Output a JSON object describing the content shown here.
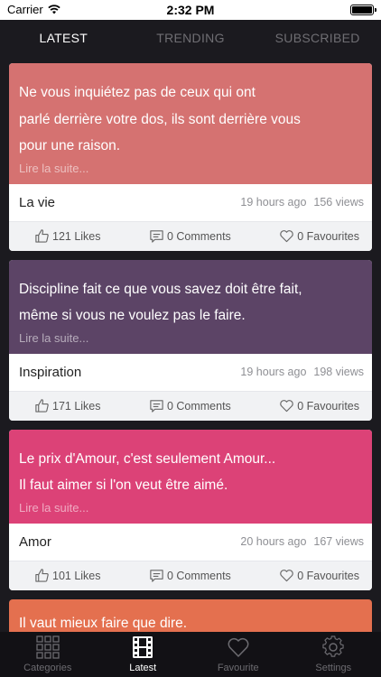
{
  "status_bar": {
    "carrier": "Carrier",
    "time": "2:32 PM"
  },
  "top_tabs": [
    {
      "label": "LATEST",
      "active": true
    },
    {
      "label": "TRENDING",
      "active": false
    },
    {
      "label": "SUBSCRIBED",
      "active": false
    }
  ],
  "cards": [
    {
      "color": "#d57271",
      "quote_lines": [
        "Ne vous inquiétez pas de ceux qui ont",
        "parlé derrière votre dos, ils sont derrière vous",
        "pour une raison."
      ],
      "more": "Lire la suite...",
      "category": "La vie",
      "ago": "19 hours ago",
      "views": "156 views",
      "likes": "121 Likes",
      "comments": "0 Comments",
      "favourites": "0 Favourites"
    },
    {
      "color": "#5c4466",
      "quote_lines": [
        "Discipline fait ce que vous savez doit être fait,",
        "même si vous ne voulez pas le faire."
      ],
      "more": "Lire la suite...",
      "category": "Inspiration",
      "ago": "19 hours ago",
      "views": "198 views",
      "likes": "171 Likes",
      "comments": "0 Comments",
      "favourites": "0 Favourites"
    },
    {
      "color": "#dc4277",
      "quote_lines": [
        "Le prix d'Amour, c'est seulement Amour...",
        "Il faut aimer si l'on veut être aimé."
      ],
      "more": "Lire la suite...",
      "category": "Amor",
      "ago": "20 hours ago",
      "views": "167 views",
      "likes": "101 Likes",
      "comments": "0 Comments",
      "favourites": "0 Favourites"
    }
  ],
  "peek_card": {
    "color": "#e4704f",
    "text": "Il vaut mieux faire que dire."
  },
  "tabbar": [
    {
      "label": "Categories",
      "icon": "grid-icon",
      "active": false
    },
    {
      "label": "Latest",
      "icon": "film-icon",
      "active": true
    },
    {
      "label": "Favourite",
      "icon": "heart-icon",
      "active": false
    },
    {
      "label": "Settings",
      "icon": "gear-icon",
      "active": false
    }
  ]
}
